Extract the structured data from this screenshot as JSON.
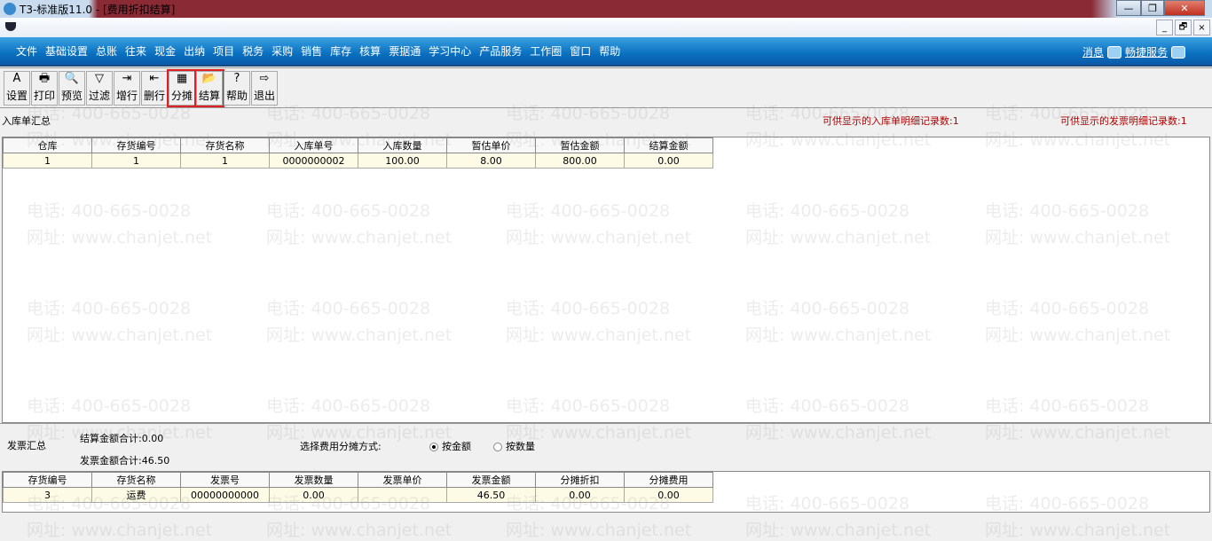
{
  "window": {
    "title": "T3-标准版11.0 - [费用折扣结算]",
    "min": "—",
    "max": "❐",
    "close": "✕"
  },
  "mdi": {
    "min": "_",
    "restore": "🗗",
    "close": "×"
  },
  "menu": [
    "文件",
    "基础设置",
    "总账",
    "往来",
    "现金",
    "出纳",
    "项目",
    "税务",
    "采购",
    "销售",
    "库存",
    "核算",
    "票据通",
    "学习中心",
    "产品服务",
    "工作圈",
    "窗口",
    "帮助"
  ],
  "menu_right": {
    "messages": "消息",
    "service": "畅捷服务"
  },
  "toolbar": [
    {
      "label": "设置",
      "icon": "A"
    },
    {
      "label": "打印",
      "icon": "🖶"
    },
    {
      "label": "预览",
      "icon": "🔍"
    },
    {
      "label": "过滤",
      "icon": "▽"
    },
    {
      "label": "增行",
      "icon": "⇥"
    },
    {
      "label": "删行",
      "icon": "⇤"
    },
    {
      "label": "分摊",
      "icon": "▦"
    },
    {
      "label": "结算",
      "icon": "📂"
    },
    {
      "label": "帮助",
      "icon": "?"
    },
    {
      "label": "退出",
      "icon": "⇨"
    }
  ],
  "receipt": {
    "title": "入库单汇总",
    "count_label": "可供显示的入库单明细记录数:1",
    "invoice_count_label": "可供显示的发票明细记录数:1",
    "columns": [
      "仓库",
      "存货编号",
      "存货名称",
      "入库单号",
      "入库数量",
      "暂估单价",
      "暂估金额",
      "结算金额"
    ],
    "rows": [
      [
        "1",
        "1",
        "1",
        "0000000002",
        "100.00",
        "8.00",
        "800.00",
        "0.00"
      ]
    ]
  },
  "invoice": {
    "title": "发票汇总",
    "settle_total": "结算金额合计:0.00",
    "invoice_total": "发票金额合计:46.50",
    "method_label": "选择费用分摊方式:",
    "opt_amount": "按金额",
    "opt_qty": "按数量",
    "columns": [
      "存货编号",
      "存货名称",
      "发票号",
      "发票数量",
      "发票单价",
      "发票金额",
      "分摊折扣",
      "分摊费用"
    ],
    "rows": [
      [
        "3",
        "运费",
        "00000000000",
        "0.00",
        "",
        "46.50",
        "0.00",
        "0.00"
      ]
    ]
  },
  "watermark": {
    "phone": "电话: 400-665-0028",
    "site": "网址: www.chanjet.net"
  }
}
